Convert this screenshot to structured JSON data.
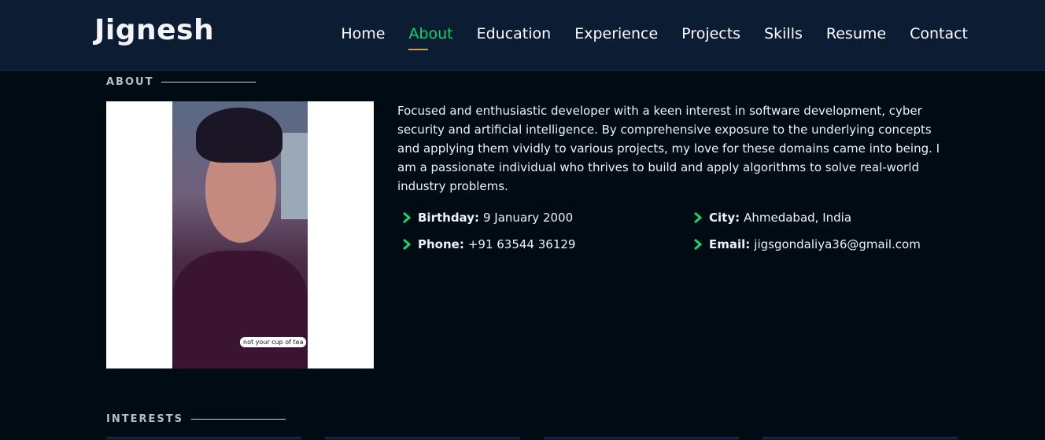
{
  "header": {
    "logo": "Jignesh",
    "nav": [
      {
        "label": "Home"
      },
      {
        "label": "About",
        "active": true
      },
      {
        "label": "Education"
      },
      {
        "label": "Experience"
      },
      {
        "label": "Projects"
      },
      {
        "label": "Skills"
      },
      {
        "label": "Resume"
      },
      {
        "label": "Contact"
      }
    ]
  },
  "about": {
    "section_title": "ABOUT",
    "photo_sticker": "not your cup of tea",
    "bio": "Focused and enthusiastic developer with a keen interest in software development, cyber security and artificial intelligence. By comprehensive exposure to the underlying concepts and applying them vividly to various projects, my love for these domains came into being. I am a passionate individual who thrives to build and apply algorithms to solve real-world industry problems.",
    "info": [
      {
        "label": "Birthday:",
        "value": "9 January 2000"
      },
      {
        "label": "City:",
        "value": "Ahmedabad, India"
      },
      {
        "label": "Phone:",
        "value": "+91 63544 36129"
      },
      {
        "label": "Email:",
        "value": "jigsgondaliya36@gmail.com"
      }
    ]
  },
  "interests": {
    "section_title": "INTERESTS"
  },
  "colors": {
    "accent": "#18d26e",
    "header_bg": "#0c1c33",
    "page_bg": "#010b14",
    "nav_underline": "#c7a44b"
  },
  "icons": {
    "info_bullet": "chevron-right-icon"
  }
}
